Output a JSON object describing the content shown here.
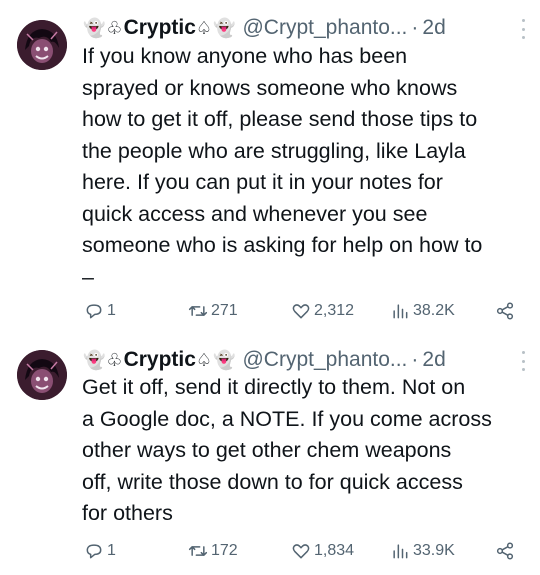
{
  "tweets": [
    {
      "display_name": "Cryptic",
      "handle": "@Crypt_phanto...",
      "separator": "·",
      "time": "2d",
      "text": "If you know anyone who has been\nsprayed or knows someone who knows\nhow to get it off, please send those tips to\nthe people who are struggling, like Layla\nhere. If you can put it in your notes for\nquick access and whenever you see\nsomeone who is asking for help on how to\n–",
      "replies": "1",
      "reposts": "271",
      "likes": "2,312",
      "views": "38.2K"
    },
    {
      "display_name": "Cryptic",
      "handle": "@Crypt_phanto...",
      "separator": "·",
      "time": "2d",
      "text": "Get it off, send it directly to them. Not on\na Google doc, a NOTE. If you come across\nother ways to get other chem weapons\noff, write those down to for quick access\nfor others",
      "replies": "1",
      "reposts": "172",
      "likes": "1,834",
      "views": "33.9K"
    }
  ],
  "icons": {
    "reply": "speech-bubble-icon",
    "repost": "repost-arrows-icon",
    "like": "heart-icon",
    "views": "bar-chart-icon",
    "share": "share-icon",
    "more": "vertical-dots-icon",
    "name_emoji": "ghost-and-spade-icons"
  },
  "colors": {
    "text": "#0f1419",
    "secondary": "#536471",
    "background": "#ffffff"
  }
}
